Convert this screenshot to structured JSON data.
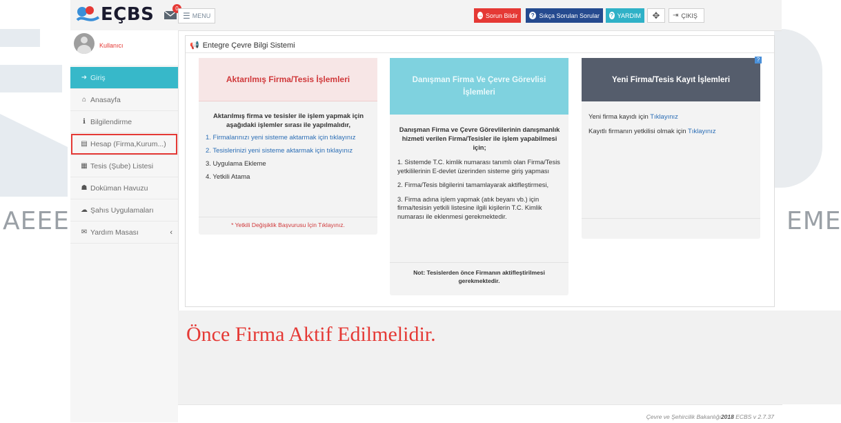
{
  "watermark": {
    "left_text": "AEEE",
    "right_text": "EME"
  },
  "header": {
    "logo_text": "EÇBS",
    "message_badge": "0",
    "menu_label": "MENU",
    "buttons": {
      "sorun": "Sorun Bildir",
      "sss": "Sıkça Sorulan Sorular",
      "yardim": "YARDIM",
      "cikis": "ÇIKIŞ"
    }
  },
  "sidebar": {
    "username": "Kullanıcı",
    "items": [
      {
        "label": "Giriş",
        "icon": "sign-in-icon",
        "glyph": "➜"
      },
      {
        "label": "Anasayfa",
        "icon": "home-icon",
        "glyph": "⌂"
      },
      {
        "label": "Bilgilendirme",
        "icon": "info-icon",
        "glyph": "ℹ"
      },
      {
        "label": "Hesap (Firma,Kurum...)",
        "icon": "building-icon",
        "glyph": "▤"
      },
      {
        "label": "Tesis (Şube) Listesi",
        "icon": "document-icon",
        "glyph": "▦"
      },
      {
        "label": "Doküman Havuzu",
        "icon": "users-icon",
        "glyph": "☗"
      },
      {
        "label": "Şahıs Uygulamaları",
        "icon": "cloud-icon",
        "glyph": "☁"
      },
      {
        "label": "Yardım Masası",
        "icon": "envelope-icon",
        "glyph": "✉"
      }
    ]
  },
  "panel": {
    "title": "Entegre Çevre Bilgi Sistemi"
  },
  "card1": {
    "title": "Aktarılmış Firma/Tesis İşlemleri",
    "intro": "Aktarılmış firma ve tesisler ile işlem yapmak için aşağıdaki işlemler sırası ile yapılmalıdır,",
    "step1": "1. Firmalarınızı yeni sisteme aktarmak için tıklayınız",
    "step2": "2. Tesislerinizi yeni sisteme aktarmak için tıklayınız",
    "step3": "3. Uygulama Ekleme",
    "step4": "4. Yetkili Atama",
    "footer_link": "* Yetkili Değişiklik Başvurusu İçin Tıklayınız."
  },
  "card2": {
    "title": "Danışman Firma Ve Çevre Görevlisi İşlemleri",
    "intro": "Danışman Firma ve Çevre Görevlilerinin danışmanlık hizmeti verilen Firma/Tesisler ile işlem yapabilmesi için;",
    "p1": "1. Sistemde T.C. kimlik numarası tanımlı olan Firma/Tesis yetkililerinin E-devlet üzerinden sisteme giriş yapması",
    "p2": "2. Firma/Tesis bilgilerini tamamlayarak aktifleştirmesi,",
    "p3": "3. Firma adına işlem yapmak (atık beyanı vb.) için firma/tesisin yetkili listesine ilgili kişilerin T.C. Kimlik numarası ile eklenmesi gerekmektedir.",
    "note": "Not: Tesislerden önce Firmanın aktifleştirilmesi gerekmektedir."
  },
  "card3": {
    "title": "Yeni Firma/Tesis Kayıt İşlemleri",
    "help_badge": "?",
    "line1_text": "Yeni firma kayıdı için",
    "line1_link": "Tıklayınız",
    "line2_text": "Kayıtlı firmanın yetkilisi olmak için",
    "line2_link": "Tıklayınız"
  },
  "warning": "Önce Firma Aktif Edilmelidir.",
  "footer": {
    "ministry": "Çevre ve Şehircilik Bakanlığı",
    "year": "2018",
    "version": "ECBS v 2.7.37"
  },
  "colors": {
    "accent_teal": "#37b8c9",
    "danger_red": "#e53935",
    "navy": "#254a8f"
  }
}
